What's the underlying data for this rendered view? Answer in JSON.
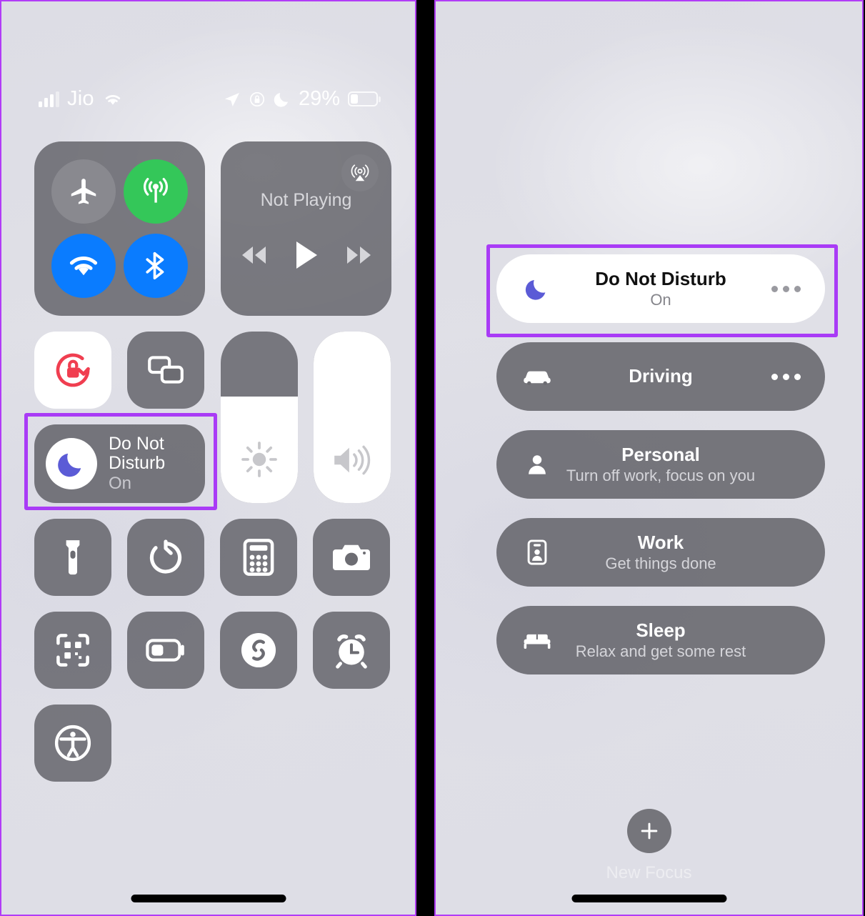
{
  "status_bar": {
    "carrier": "Jio",
    "signal_icon": "cellular-signal-icon",
    "wifi_icon": "wifi-icon",
    "location_icon": "location-arrow-icon",
    "rotation_lock_icon": "rotation-lock-icon",
    "dnd_icon": "moon-icon",
    "battery_percent": "29%",
    "battery_level": 29,
    "battery_icon": "battery-icon"
  },
  "control_center": {
    "connectivity": {
      "airplane": {
        "name": "Airplane Mode",
        "icon": "airplane-icon",
        "state": "off"
      },
      "cellular": {
        "name": "Cellular Data",
        "icon": "cellular-antenna-icon",
        "state": "on"
      },
      "wifi": {
        "name": "Wi-Fi",
        "icon": "wifi-icon",
        "state": "on"
      },
      "bluetooth": {
        "name": "Bluetooth",
        "icon": "bluetooth-icon",
        "state": "on"
      }
    },
    "media": {
      "title": "Not Playing",
      "airplay_icon": "airplay-audio-icon",
      "rewind_icon": "rewind-icon",
      "play_icon": "play-icon",
      "forward_icon": "fast-forward-icon"
    },
    "rotation_lock": {
      "name": "Rotation Lock",
      "icon": "rotation-lock-icon",
      "state": "on"
    },
    "screen_mirroring": {
      "name": "Screen Mirroring",
      "icon": "screen-mirroring-icon",
      "state": "off"
    },
    "focus_tile": {
      "title": "Do Not Disturb",
      "title_line1": "Do Not",
      "title_line2": "Disturb",
      "state": "On",
      "icon": "moon-icon"
    },
    "brightness": {
      "name": "Brightness",
      "icon": "brightness-sun-icon",
      "level": 62
    },
    "volume": {
      "name": "Volume",
      "icon": "speaker-waves-icon",
      "level": 100
    },
    "shortcuts": [
      {
        "name": "Flashlight",
        "icon": "flashlight-icon"
      },
      {
        "name": "Timer",
        "icon": "timer-icon"
      },
      {
        "name": "Calculator",
        "icon": "calculator-icon"
      },
      {
        "name": "Camera",
        "icon": "camera-icon"
      },
      {
        "name": "Code Scanner",
        "icon": "qr-scanner-icon"
      },
      {
        "name": "Low Power Mode",
        "icon": "low-power-battery-icon"
      },
      {
        "name": "Shazam",
        "icon": "shazam-icon"
      },
      {
        "name": "Alarm",
        "icon": "alarm-clock-icon"
      },
      {
        "name": "Accessibility Shortcuts",
        "icon": "accessibility-icon"
      }
    ]
  },
  "focus_panel": {
    "modes": [
      {
        "title": "Do Not Disturb",
        "subtitle": "On",
        "icon": "moon-icon",
        "active": true,
        "has_more": true
      },
      {
        "title": "Driving",
        "subtitle": "",
        "icon": "car-icon",
        "active": false,
        "has_more": true
      },
      {
        "title": "Personal",
        "subtitle": "Turn off work, focus on you",
        "icon": "person-icon",
        "active": false,
        "has_more": false
      },
      {
        "title": "Work",
        "subtitle": "Get things done",
        "icon": "id-badge-icon",
        "active": false,
        "has_more": false
      },
      {
        "title": "Sleep",
        "subtitle": "Relax and get some rest",
        "icon": "bed-icon",
        "active": false,
        "has_more": false
      }
    ],
    "new_focus": {
      "label": "New Focus",
      "icon": "plus-icon"
    }
  },
  "annotations": {
    "highlight_color": "#A93BF6",
    "left_highlight_target": "Do Not Disturb control-center tile",
    "right_highlight_target": "Do Not Disturb focus mode row"
  },
  "colors": {
    "accent_green": "#34C759",
    "accent_blue": "#0A7CFF",
    "moon_purple": "#5B5BD6",
    "lock_red": "#F03E50",
    "module_gray": "#5A5A60",
    "background": "#DEDEE6"
  }
}
